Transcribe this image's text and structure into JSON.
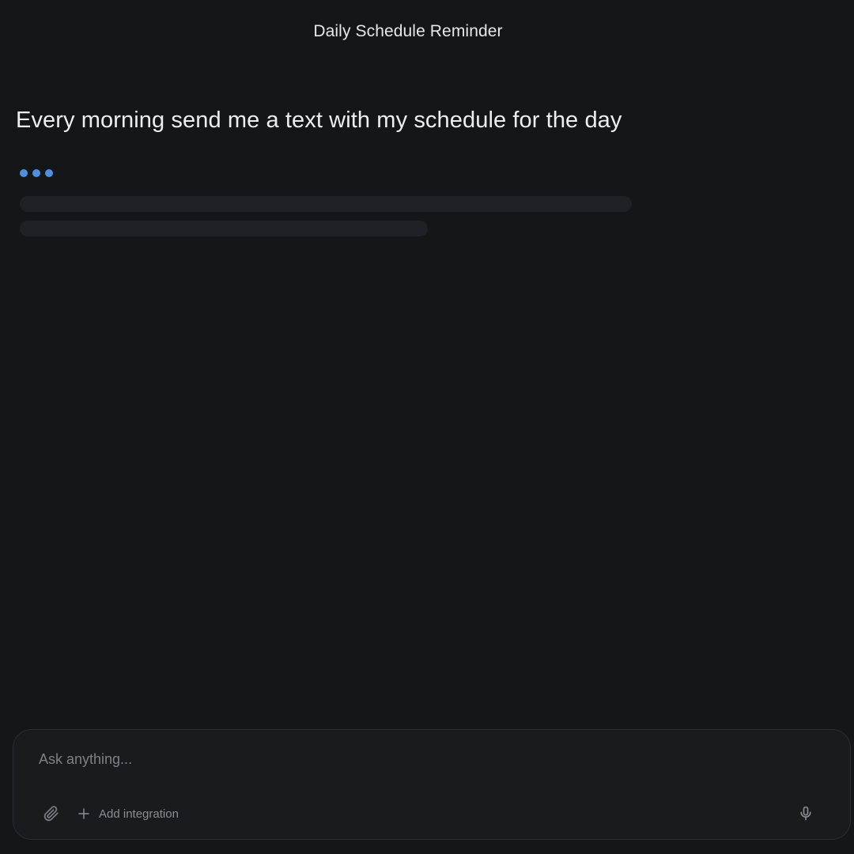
{
  "header": {
    "title": "Daily Schedule Reminder"
  },
  "conversation": {
    "user_message": "Every morning send me a text with my schedule for the day",
    "assistant_status": "typing"
  },
  "composer": {
    "placeholder": "Ask anything...",
    "value": "",
    "add_integration_label": "Add integration",
    "icons": {
      "attach": "paperclip-icon",
      "add": "plus-icon",
      "mic": "microphone-icon"
    }
  },
  "colors": {
    "background": "#141618",
    "accent": "#4f8fdf",
    "skeleton": "#1e2227",
    "composer_bg": "#1a1b1d"
  }
}
